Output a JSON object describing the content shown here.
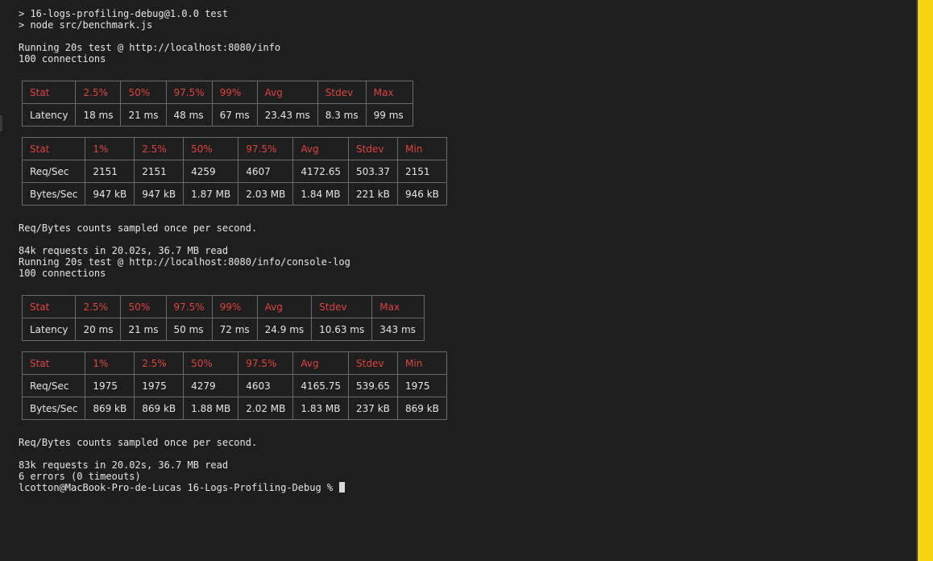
{
  "header_lines": [
    "> 16-logs-profiling-debug@1.0.0 test",
    "> node src/benchmark.js"
  ],
  "run1": {
    "intro": [
      "Running 20s test @ http://localhost:8080/info",
      "100 connections"
    ],
    "latency_table": {
      "headers": [
        "Stat",
        "2.5%",
        "50%",
        "97.5%",
        "99%",
        "Avg",
        "Stdev",
        "Max"
      ],
      "rows": [
        [
          "Latency",
          "18 ms",
          "21 ms",
          "48 ms",
          "67 ms",
          "23.43 ms",
          "8.3 ms",
          "99 ms"
        ]
      ]
    },
    "throughput_table": {
      "headers": [
        "Stat",
        "1%",
        "2.5%",
        "50%",
        "97.5%",
        "Avg",
        "Stdev",
        "Min"
      ],
      "rows": [
        [
          "Req/Sec",
          "2151",
          "2151",
          "4259",
          "4607",
          "4172.65",
          "503.37",
          "2151"
        ],
        [
          "Bytes/Sec",
          "947 kB",
          "947 kB",
          "1.87 MB",
          "2.03 MB",
          "1.84 MB",
          "221 kB",
          "946 kB"
        ]
      ]
    },
    "note": "Req/Bytes counts sampled once per second.",
    "summary": "84k requests in 20.02s, 36.7 MB read"
  },
  "run2": {
    "intro": [
      "Running 20s test @ http://localhost:8080/info/console-log",
      "100 connections"
    ],
    "latency_table": {
      "headers": [
        "Stat",
        "2.5%",
        "50%",
        "97.5%",
        "99%",
        "Avg",
        "Stdev",
        "Max"
      ],
      "rows": [
        [
          "Latency",
          "20 ms",
          "21 ms",
          "50 ms",
          "72 ms",
          "24.9 ms",
          "10.63 ms",
          "343 ms"
        ]
      ]
    },
    "throughput_table": {
      "headers": [
        "Stat",
        "1%",
        "2.5%",
        "50%",
        "97.5%",
        "Avg",
        "Stdev",
        "Min"
      ],
      "rows": [
        [
          "Req/Sec",
          "1975",
          "1975",
          "4279",
          "4603",
          "4165.75",
          "539.65",
          "1975"
        ],
        [
          "Bytes/Sec",
          "869 kB",
          "869 kB",
          "1.88 MB",
          "2.02 MB",
          "1.83 MB",
          "237 kB",
          "869 kB"
        ]
      ]
    },
    "note": "Req/Bytes counts sampled once per second.",
    "summary": "83k requests in 20.02s, 36.7 MB read",
    "errors": "6 errors (0 timeouts)"
  },
  "prompt": "lcotton@MacBook-Pro-de-Lucas 16-Logs-Profiling-Debug % ",
  "colors": {
    "background": "#1e1e1e",
    "text": "#e6e6e6",
    "header_red": "#e0443e",
    "table_border": "#6a6a6a",
    "side_strip": "#f5d20f"
  }
}
